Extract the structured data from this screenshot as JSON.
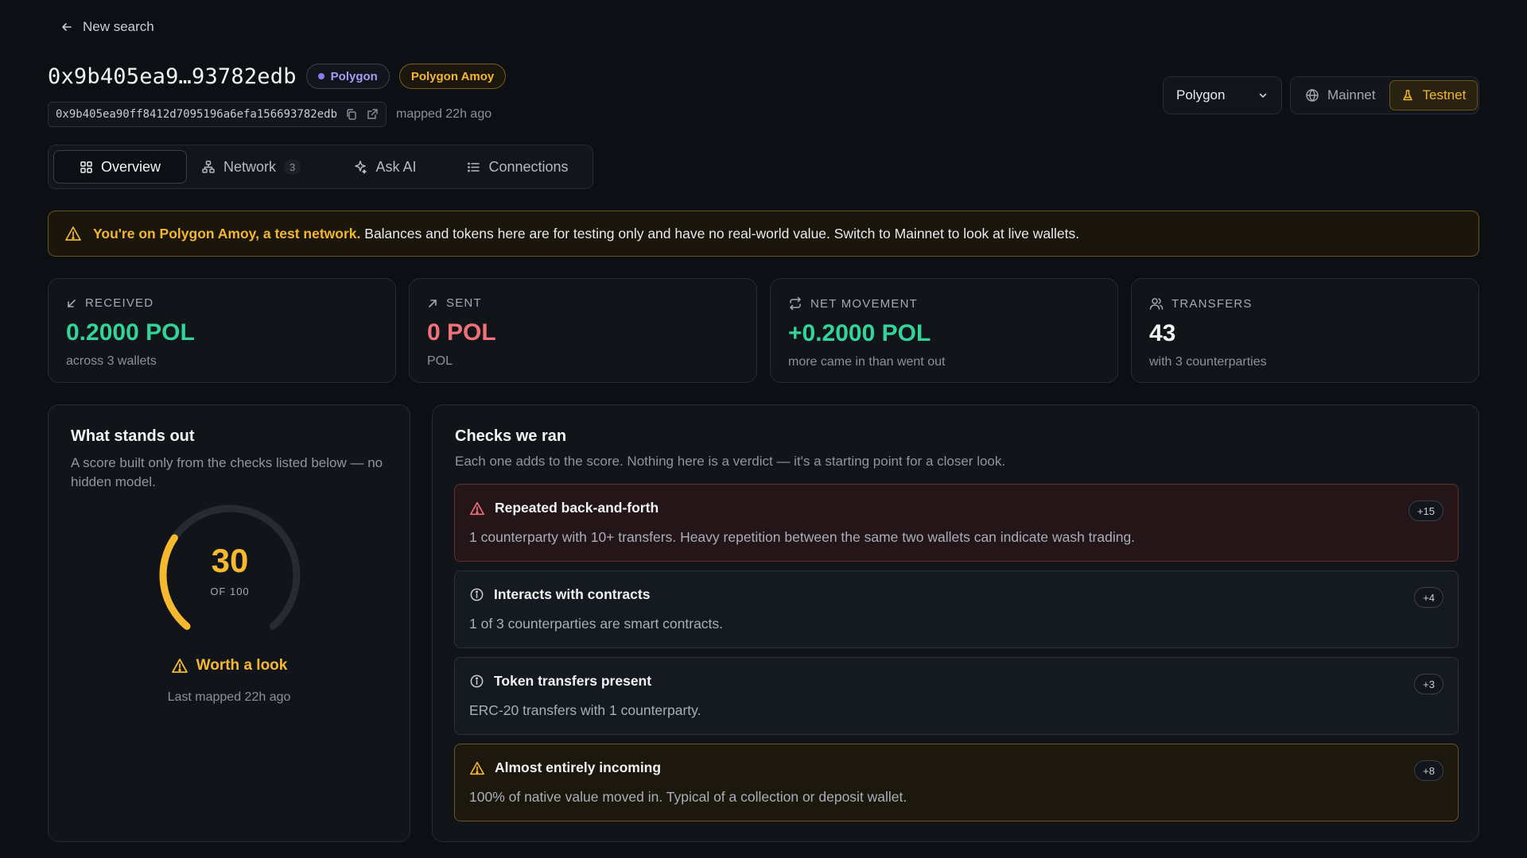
{
  "nav": {
    "back_label": "New search"
  },
  "header": {
    "address_short": "0x9b405ea9…93782edb",
    "chain_chip": "Polygon",
    "network_chip": "Polygon Amoy",
    "address_full": "0x9b405ea90ff8412d7095196a6efa156693782edb",
    "mapped": "mapped 22h ago"
  },
  "controls": {
    "chain_select": "Polygon",
    "mainnet_label": "Mainnet",
    "testnet_label": "Testnet"
  },
  "tabs": [
    {
      "label": "Overview",
      "active": true
    },
    {
      "label": "Network",
      "badge": "3"
    },
    {
      "label": "Ask AI"
    },
    {
      "label": "Connections"
    }
  ],
  "banner": {
    "strong": "You're on Polygon Amoy, a test network.",
    "text": "Balances and tokens here are for testing only and have no real-world value. Switch to Mainnet to look at live wallets."
  },
  "stats": [
    {
      "label": "RECEIVED",
      "value": "0.2000 POL",
      "sub": "across 3 wallets",
      "color": "#34d39a"
    },
    {
      "label": "SENT",
      "value": "0 POL",
      "sub": "POL",
      "color": "#f0717a"
    },
    {
      "label": "NET MOVEMENT",
      "value": "+0.2000 POL",
      "sub": "more came in than went out",
      "color": "#34d39a"
    },
    {
      "label": "TRANSFERS",
      "value": "43",
      "sub": "with 3 counterparties",
      "color": "#f3f4f6"
    }
  ],
  "score": {
    "title": "What stands out",
    "subtitle": "A score built only from the checks listed below — no hidden model.",
    "value": 30,
    "max_label": "OF 100",
    "verdict": "Worth a look",
    "last_mapped": "Last mapped 22h ago",
    "accent": "#f5b82e"
  },
  "checks": {
    "title": "Checks we ran",
    "subtitle": "Each one adds to the score. Nothing here is a verdict — it's a starting point for a closer look.",
    "items": [
      {
        "title": "Repeated back-and-forth",
        "desc": "1 counterparty with 10+ transfers. Heavy repetition between the same two wallets can indicate wash trading.",
        "points": "+15",
        "severity": "danger"
      },
      {
        "title": "Interacts with contracts",
        "desc": "1 of 3 counterparties are smart contracts.",
        "points": "+4",
        "severity": "info"
      },
      {
        "title": "Token transfers present",
        "desc": "ERC-20 transfers with 1 counterparty.",
        "points": "+3",
        "severity": "info"
      },
      {
        "title": "Almost entirely incoming",
        "desc": "100% of native value moved in. Typical of a collection or deposit wallet.",
        "points": "+8",
        "severity": "warn"
      }
    ]
  }
}
